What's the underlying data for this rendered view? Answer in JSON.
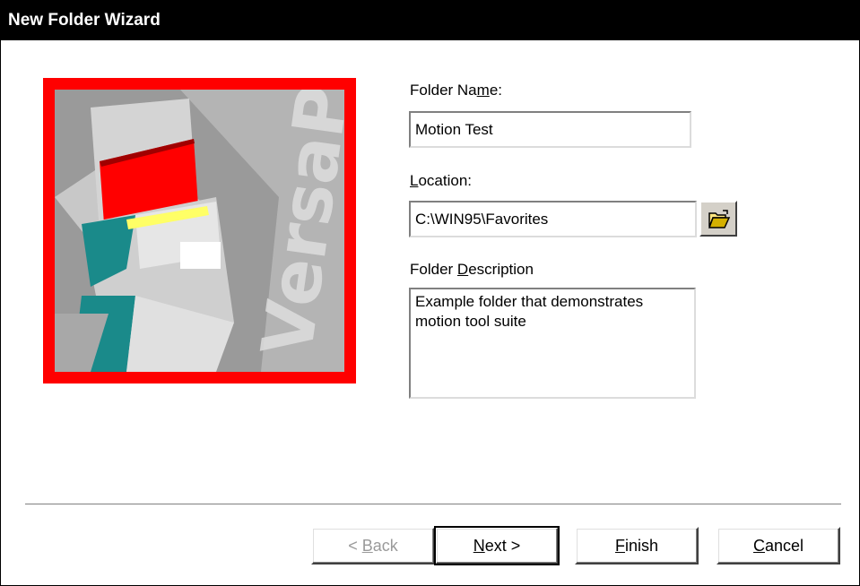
{
  "window": {
    "title": "New Folder Wizard"
  },
  "form": {
    "folder_name": {
      "label_pre": "Folder Na",
      "label_key": "m",
      "label_post": "e:",
      "value": "Motion Test"
    },
    "location": {
      "label_pre": "",
      "label_key": "L",
      "label_post": "ocation:",
      "value": "C:\\WIN95\\Favorites"
    },
    "description": {
      "label_pre": "Folder ",
      "label_key": "D",
      "label_post": "escription",
      "value": "Example folder that demonstrates\nmotion tool suite"
    }
  },
  "art": {
    "brand_text": "VersaPro",
    "frame_color": "#ff0000"
  },
  "buttons": {
    "back": {
      "pre": "< ",
      "key": "B",
      "post": "ack",
      "enabled": false
    },
    "next": {
      "pre": "",
      "key": "N",
      "post": "ext >",
      "default": true
    },
    "finish": {
      "pre": "",
      "key": "F",
      "post": "inish"
    },
    "cancel": {
      "pre": "",
      "key": "C",
      "post": "ancel"
    }
  },
  "icons": {
    "browse": "open-folder-icon"
  }
}
